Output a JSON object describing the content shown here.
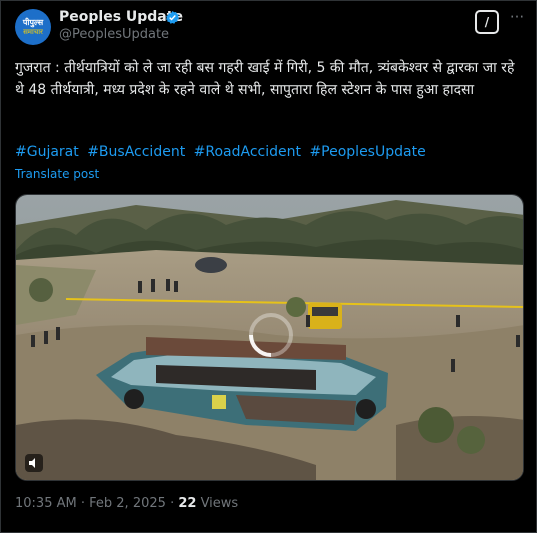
{
  "author": {
    "name": "Peoples Update",
    "handle": "@PeoplesUpdate",
    "avatar_line1": "पीपुल्स",
    "avatar_line2": "समाचार"
  },
  "post": {
    "text": "गुजरात : तीर्थयात्रियों को ले जा रही बस गहरी खाई में गिरी, 5 की मौत, त्र्यंबकेश्वर से द्वारका जा रहे थे 48 तीर्थयात्री, मध्य प्रदेश के रहने वाले थे सभी, सापुतारा हिल स्टेशन के पास हुआ हादसा",
    "hashtags": [
      "#Gujarat",
      "#BusAccident",
      "#RoadAccident",
      "#PeoplesUpdate"
    ],
    "translate_label": "Translate post"
  },
  "meta": {
    "time": "10:35 AM",
    "separator": "·",
    "date": "Feb 2, 2025",
    "views_count": "22",
    "views_label": "Views"
  },
  "icons": {
    "verified": "verified-badge-icon",
    "grok": "grok-icon",
    "more": "more-options-icon",
    "mute": "mute-icon"
  },
  "colors": {
    "accent": "#1d9bf0",
    "background": "#000000",
    "text": "#e7e9ea",
    "muted": "#71767b"
  }
}
